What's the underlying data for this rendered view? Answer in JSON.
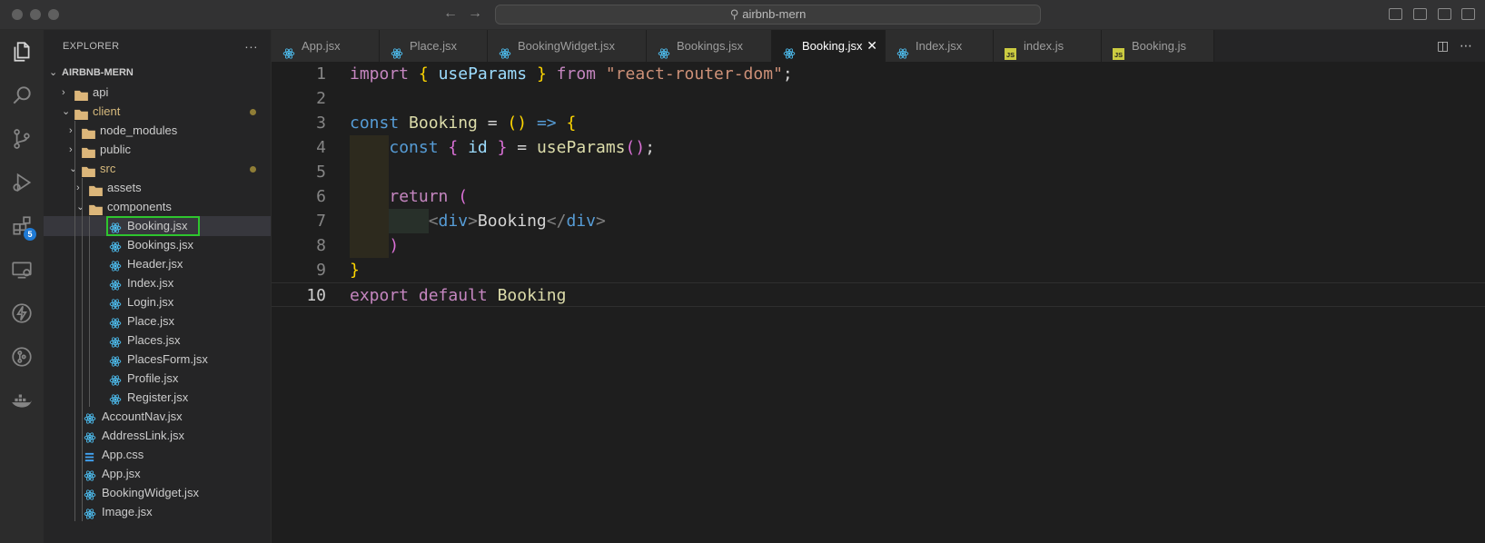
{
  "window": {
    "search_text": "airbnb-mern"
  },
  "activity_bar": {
    "items": [
      "explorer",
      "search",
      "source-control",
      "run-debug",
      "extensions",
      "remote-explorer",
      "thunder-client",
      "gitlens",
      "docker"
    ],
    "extensions_badge": "5"
  },
  "sidebar": {
    "title": "EXPLORER",
    "more_actions": "···",
    "project_name": "AIRBNB-MERN",
    "tree": [
      {
        "label": "api",
        "type": "folder",
        "expanded": false,
        "depth": 0
      },
      {
        "label": "client",
        "type": "folder",
        "expanded": true,
        "depth": 0,
        "modified": true
      },
      {
        "label": "node_modules",
        "type": "folder",
        "expanded": false,
        "depth": 1
      },
      {
        "label": "public",
        "type": "folder",
        "expanded": false,
        "depth": 1
      },
      {
        "label": "src",
        "type": "folder",
        "expanded": true,
        "depth": 1,
        "modified": true
      },
      {
        "label": "assets",
        "type": "folder",
        "expanded": false,
        "depth": 2
      },
      {
        "label": "components",
        "type": "folder",
        "expanded": true,
        "depth": 2
      },
      {
        "label": "Booking.jsx",
        "type": "jsx",
        "depth": 3,
        "selected": true
      },
      {
        "label": "Bookings.jsx",
        "type": "jsx",
        "depth": 3
      },
      {
        "label": "Header.jsx",
        "type": "jsx",
        "depth": 3
      },
      {
        "label": "Index.jsx",
        "type": "jsx",
        "depth": 3
      },
      {
        "label": "Login.jsx",
        "type": "jsx",
        "depth": 3
      },
      {
        "label": "Place.jsx",
        "type": "jsx",
        "depth": 3
      },
      {
        "label": "Places.jsx",
        "type": "jsx",
        "depth": 3
      },
      {
        "label": "PlacesForm.jsx",
        "type": "jsx",
        "depth": 3
      },
      {
        "label": "Profile.jsx",
        "type": "jsx",
        "depth": 3
      },
      {
        "label": "Register.jsx",
        "type": "jsx",
        "depth": 3
      },
      {
        "label": "AccountNav.jsx",
        "type": "jsx",
        "depth": 2
      },
      {
        "label": "AddressLink.jsx",
        "type": "jsx",
        "depth": 2
      },
      {
        "label": "App.css",
        "type": "css",
        "depth": 2
      },
      {
        "label": "App.jsx",
        "type": "jsx",
        "depth": 2
      },
      {
        "label": "BookingWidget.jsx",
        "type": "jsx",
        "depth": 2
      },
      {
        "label": "Image.jsx",
        "type": "jsx",
        "depth": 2
      }
    ]
  },
  "tabs": [
    {
      "label": "App.jsx",
      "type": "jsx"
    },
    {
      "label": "Place.jsx",
      "type": "jsx"
    },
    {
      "label": "BookingWidget.jsx",
      "type": "jsx"
    },
    {
      "label": "Bookings.jsx",
      "type": "jsx"
    },
    {
      "label": "Booking.jsx",
      "type": "jsx",
      "active": true
    },
    {
      "label": "Index.jsx",
      "type": "jsx"
    },
    {
      "label": "index.js",
      "type": "js"
    },
    {
      "label": "Booking.js",
      "type": "js"
    }
  ],
  "tab_close_glyph": "✕",
  "editor": {
    "current_line": 10,
    "lines": [
      [
        [
          "kw",
          "import"
        ],
        [
          "plain",
          " "
        ],
        [
          "br1",
          "{"
        ],
        [
          "plain",
          " "
        ],
        [
          "var",
          "useParams"
        ],
        [
          "plain",
          " "
        ],
        [
          "br1",
          "}"
        ],
        [
          "plain",
          " "
        ],
        [
          "kw",
          "from"
        ],
        [
          "plain",
          " "
        ],
        [
          "str",
          "\"react-router-dom\""
        ],
        [
          "plain",
          ";"
        ]
      ],
      [],
      [
        [
          "kwb",
          "const"
        ],
        [
          "plain",
          " "
        ],
        [
          "fn",
          "Booking"
        ],
        [
          "plain",
          " = "
        ],
        [
          "br1",
          "()"
        ],
        [
          "plain",
          " "
        ],
        [
          "kwb",
          "=>"
        ],
        [
          "plain",
          " "
        ],
        [
          "br1",
          "{"
        ]
      ],
      [
        [
          "plain",
          "    "
        ],
        [
          "kwb",
          "const"
        ],
        [
          "plain",
          " "
        ],
        [
          "br2",
          "{"
        ],
        [
          "plain",
          " "
        ],
        [
          "var",
          "id"
        ],
        [
          "plain",
          " "
        ],
        [
          "br2",
          "}"
        ],
        [
          "plain",
          " = "
        ],
        [
          "fn",
          "useParams"
        ],
        [
          "br2",
          "()"
        ],
        [
          "plain",
          ";"
        ]
      ],
      [],
      [
        [
          "plain",
          "    "
        ],
        [
          "kw",
          "return"
        ],
        [
          "plain",
          " "
        ],
        [
          "br2",
          "("
        ]
      ],
      [
        [
          "plain",
          "        "
        ],
        [
          "punct",
          "<"
        ],
        [
          "tag",
          "div"
        ],
        [
          "punct",
          ">"
        ],
        [
          "plain",
          "Booking"
        ],
        [
          "punct",
          "</"
        ],
        [
          "tag",
          "div"
        ],
        [
          "punct",
          ">"
        ]
      ],
      [
        [
          "plain",
          "    "
        ],
        [
          "br2",
          ")"
        ]
      ],
      [
        [
          "br1",
          "}"
        ]
      ],
      [
        [
          "kw",
          "export"
        ],
        [
          "plain",
          " "
        ],
        [
          "kw",
          "default"
        ],
        [
          "plain",
          " "
        ],
        [
          "fn",
          "Booking"
        ]
      ]
    ]
  },
  "colors": {
    "react_icon": "#4fc3f7",
    "folder": "#dcb67a",
    "js_icon": "#cbcb41",
    "css_icon": "#42a5f5",
    "selection_outline": "#2ec52e"
  }
}
